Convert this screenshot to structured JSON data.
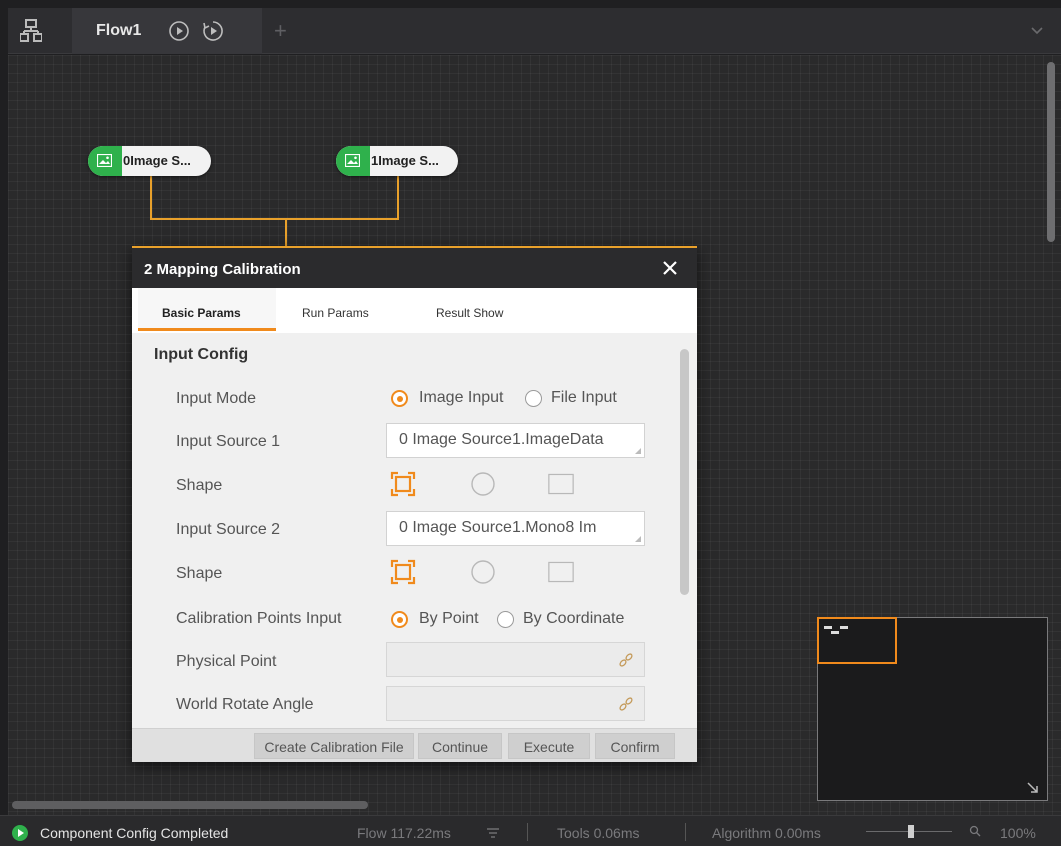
{
  "colors": {
    "accent": "#f08a1c",
    "node_green": "#2fb14c",
    "wire": "#e9a12b"
  },
  "topbar": {
    "flow_icon": "process-tree-icon",
    "tab_title": "Flow1",
    "run_icon": "play-circle-icon",
    "loop_icon": "loop-run-icon",
    "add_tab": "+",
    "menu_icon": "chevron-down-icon"
  },
  "nodes": [
    {
      "label": "0Image S...",
      "icon": "image-icon"
    },
    {
      "label": "1Image S...",
      "icon": "image-icon"
    }
  ],
  "dialog": {
    "title": "2 Mapping Calibration",
    "tabs": [
      {
        "label": "Basic Params",
        "active": true
      },
      {
        "label": "Run Params",
        "active": false
      },
      {
        "label": "Result Show",
        "active": false
      }
    ],
    "section": "Input Config",
    "input_mode": {
      "label": "Input Mode",
      "options": [
        "Image Input",
        "File Input"
      ],
      "selected": "Image Input"
    },
    "input_source_1": {
      "label": "Input Source 1",
      "value": "0 Image Source1.ImageData"
    },
    "shape_1": {
      "label": "Shape",
      "options": [
        "roi-box-icon",
        "circle-icon",
        "rectangle-icon"
      ],
      "selected": "roi-box-icon"
    },
    "input_source_2": {
      "label": "Input Source 2",
      "value": "0 Image Source1.Mono8 Im"
    },
    "shape_2": {
      "label": "Shape",
      "options": [
        "roi-box-icon",
        "circle-icon",
        "rectangle-icon"
      ],
      "selected": "roi-box-icon"
    },
    "calib_points": {
      "label": "Calibration Points Input",
      "options": [
        "By Point",
        "By Coordinate"
      ],
      "selected": "By Point"
    },
    "physical_point": {
      "label": "Physical Point",
      "value": ""
    },
    "world_rotate_angle": {
      "label": "World Rotate Angle",
      "value": ""
    },
    "buttons": {
      "create_calib": "Create Calibration File",
      "continue": "Continue",
      "execute": "Execute",
      "confirm": "Confirm"
    }
  },
  "status": {
    "message": "Component Config Completed",
    "flow": "Flow  117.22ms",
    "tools": "Tools  0.06ms",
    "algorithm": "Algorithm  0.00ms",
    "zoom": "100%"
  }
}
